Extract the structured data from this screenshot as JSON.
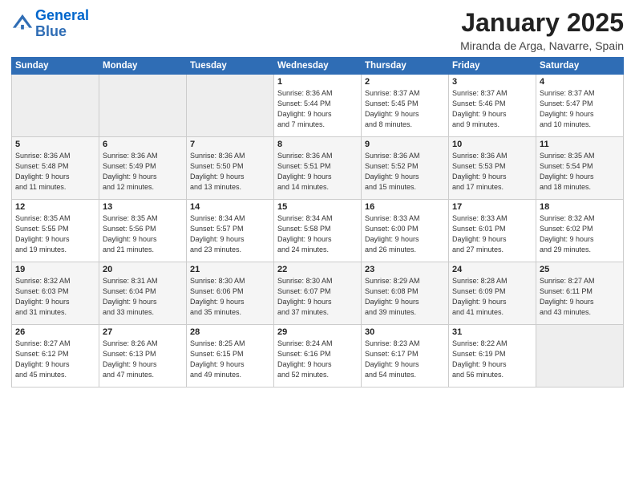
{
  "header": {
    "logo_line1": "General",
    "logo_line2": "Blue",
    "month": "January 2025",
    "location": "Miranda de Arga, Navarre, Spain"
  },
  "weekdays": [
    "Sunday",
    "Monday",
    "Tuesday",
    "Wednesday",
    "Thursday",
    "Friday",
    "Saturday"
  ],
  "weeks": [
    [
      {
        "day": "",
        "info": ""
      },
      {
        "day": "",
        "info": ""
      },
      {
        "day": "",
        "info": ""
      },
      {
        "day": "1",
        "info": "Sunrise: 8:36 AM\nSunset: 5:44 PM\nDaylight: 9 hours\nand 7 minutes."
      },
      {
        "day": "2",
        "info": "Sunrise: 8:37 AM\nSunset: 5:45 PM\nDaylight: 9 hours\nand 8 minutes."
      },
      {
        "day": "3",
        "info": "Sunrise: 8:37 AM\nSunset: 5:46 PM\nDaylight: 9 hours\nand 9 minutes."
      },
      {
        "day": "4",
        "info": "Sunrise: 8:37 AM\nSunset: 5:47 PM\nDaylight: 9 hours\nand 10 minutes."
      }
    ],
    [
      {
        "day": "5",
        "info": "Sunrise: 8:36 AM\nSunset: 5:48 PM\nDaylight: 9 hours\nand 11 minutes."
      },
      {
        "day": "6",
        "info": "Sunrise: 8:36 AM\nSunset: 5:49 PM\nDaylight: 9 hours\nand 12 minutes."
      },
      {
        "day": "7",
        "info": "Sunrise: 8:36 AM\nSunset: 5:50 PM\nDaylight: 9 hours\nand 13 minutes."
      },
      {
        "day": "8",
        "info": "Sunrise: 8:36 AM\nSunset: 5:51 PM\nDaylight: 9 hours\nand 14 minutes."
      },
      {
        "day": "9",
        "info": "Sunrise: 8:36 AM\nSunset: 5:52 PM\nDaylight: 9 hours\nand 15 minutes."
      },
      {
        "day": "10",
        "info": "Sunrise: 8:36 AM\nSunset: 5:53 PM\nDaylight: 9 hours\nand 17 minutes."
      },
      {
        "day": "11",
        "info": "Sunrise: 8:35 AM\nSunset: 5:54 PM\nDaylight: 9 hours\nand 18 minutes."
      }
    ],
    [
      {
        "day": "12",
        "info": "Sunrise: 8:35 AM\nSunset: 5:55 PM\nDaylight: 9 hours\nand 19 minutes."
      },
      {
        "day": "13",
        "info": "Sunrise: 8:35 AM\nSunset: 5:56 PM\nDaylight: 9 hours\nand 21 minutes."
      },
      {
        "day": "14",
        "info": "Sunrise: 8:34 AM\nSunset: 5:57 PM\nDaylight: 9 hours\nand 23 minutes."
      },
      {
        "day": "15",
        "info": "Sunrise: 8:34 AM\nSunset: 5:58 PM\nDaylight: 9 hours\nand 24 minutes."
      },
      {
        "day": "16",
        "info": "Sunrise: 8:33 AM\nSunset: 6:00 PM\nDaylight: 9 hours\nand 26 minutes."
      },
      {
        "day": "17",
        "info": "Sunrise: 8:33 AM\nSunset: 6:01 PM\nDaylight: 9 hours\nand 27 minutes."
      },
      {
        "day": "18",
        "info": "Sunrise: 8:32 AM\nSunset: 6:02 PM\nDaylight: 9 hours\nand 29 minutes."
      }
    ],
    [
      {
        "day": "19",
        "info": "Sunrise: 8:32 AM\nSunset: 6:03 PM\nDaylight: 9 hours\nand 31 minutes."
      },
      {
        "day": "20",
        "info": "Sunrise: 8:31 AM\nSunset: 6:04 PM\nDaylight: 9 hours\nand 33 minutes."
      },
      {
        "day": "21",
        "info": "Sunrise: 8:30 AM\nSunset: 6:06 PM\nDaylight: 9 hours\nand 35 minutes."
      },
      {
        "day": "22",
        "info": "Sunrise: 8:30 AM\nSunset: 6:07 PM\nDaylight: 9 hours\nand 37 minutes."
      },
      {
        "day": "23",
        "info": "Sunrise: 8:29 AM\nSunset: 6:08 PM\nDaylight: 9 hours\nand 39 minutes."
      },
      {
        "day": "24",
        "info": "Sunrise: 8:28 AM\nSunset: 6:09 PM\nDaylight: 9 hours\nand 41 minutes."
      },
      {
        "day": "25",
        "info": "Sunrise: 8:27 AM\nSunset: 6:11 PM\nDaylight: 9 hours\nand 43 minutes."
      }
    ],
    [
      {
        "day": "26",
        "info": "Sunrise: 8:27 AM\nSunset: 6:12 PM\nDaylight: 9 hours\nand 45 minutes."
      },
      {
        "day": "27",
        "info": "Sunrise: 8:26 AM\nSunset: 6:13 PM\nDaylight: 9 hours\nand 47 minutes."
      },
      {
        "day": "28",
        "info": "Sunrise: 8:25 AM\nSunset: 6:15 PM\nDaylight: 9 hours\nand 49 minutes."
      },
      {
        "day": "29",
        "info": "Sunrise: 8:24 AM\nSunset: 6:16 PM\nDaylight: 9 hours\nand 52 minutes."
      },
      {
        "day": "30",
        "info": "Sunrise: 8:23 AM\nSunset: 6:17 PM\nDaylight: 9 hours\nand 54 minutes."
      },
      {
        "day": "31",
        "info": "Sunrise: 8:22 AM\nSunset: 6:19 PM\nDaylight: 9 hours\nand 56 minutes."
      },
      {
        "day": "",
        "info": ""
      }
    ]
  ]
}
